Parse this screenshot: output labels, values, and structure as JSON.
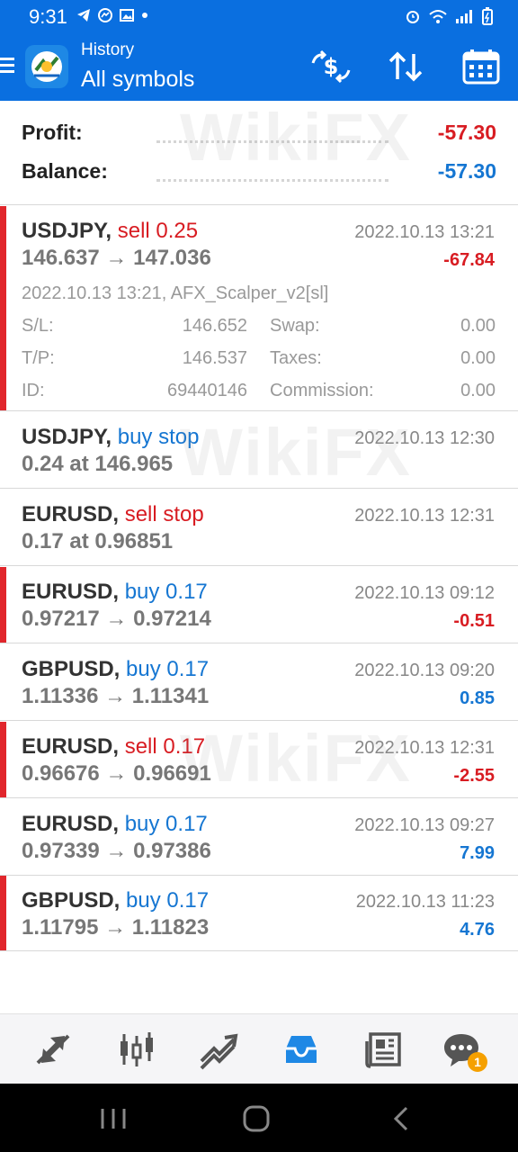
{
  "status_bar": {
    "time": "9:31"
  },
  "header": {
    "subtitle": "History",
    "title": "All symbols",
    "icons": [
      "menu-icon",
      "app-logo",
      "currency-exchange-icon",
      "sort-icon",
      "calendar-icon"
    ]
  },
  "summary": {
    "profit_label": "Profit:",
    "profit_value": "-57.30",
    "balance_label": "Balance:",
    "balance_value": "-57.30"
  },
  "trades": [
    {
      "symbol": "USDJPY,",
      "side": "sell 0.25",
      "side_type": "sell",
      "prices": "146.637 → 147.036",
      "time": "2022.10.13 13:21",
      "profit": "-67.84",
      "marker": true,
      "details": {
        "comment": "2022.10.13 13:21, AFX_Scalper_v2[sl]",
        "sl_label": "S/L:",
        "sl_value": "146.652",
        "tp_label": "T/P:",
        "tp_value": "146.537",
        "id_label": "ID:",
        "id_value": "69440146",
        "swap_label": "Swap:",
        "swap_value": "0.00",
        "taxes_label": "Taxes:",
        "taxes_value": "0.00",
        "commission_label": "Commission:",
        "commission_value": "0.00"
      }
    },
    {
      "symbol": "USDJPY,",
      "side": "buy stop",
      "side_type": "buy",
      "prices": "0.24 at 146.965",
      "time": "2022.10.13 12:30",
      "profit": "",
      "marker": false
    },
    {
      "symbol": "EURUSD,",
      "side": "sell stop",
      "side_type": "sell",
      "prices": "0.17 at 0.96851",
      "time": "2022.10.13 12:31",
      "profit": "",
      "marker": false
    },
    {
      "symbol": "EURUSD,",
      "side": "buy 0.17",
      "side_type": "buy",
      "prices": "0.97217 → 0.97214",
      "time": "2022.10.13 09:12",
      "profit": "-0.51",
      "marker": true
    },
    {
      "symbol": "GBPUSD,",
      "side": "buy 0.17",
      "side_type": "buy",
      "prices": "1.11336 → 1.11341",
      "time": "2022.10.13 09:20",
      "profit": "0.85",
      "marker": false
    },
    {
      "symbol": "EURUSD,",
      "side": "sell 0.17",
      "side_type": "sell",
      "prices": "0.96676 → 0.96691",
      "time": "2022.10.13 12:31",
      "profit": "-2.55",
      "marker": true
    },
    {
      "symbol": "EURUSD,",
      "side": "buy 0.17",
      "side_type": "buy",
      "prices": "0.97339 → 0.97386",
      "time": "2022.10.13 09:27",
      "profit": "7.99",
      "marker": false
    },
    {
      "symbol": "GBPUSD,",
      "side": "buy 0.17",
      "side_type": "buy",
      "prices": "1.11795 → 1.11823",
      "time": "2022.10.13 11:23",
      "profit": "4.76",
      "marker": true
    }
  ],
  "bottom_nav": {
    "items": [
      "quotes-icon",
      "chart-icon",
      "trade-icon",
      "history-icon",
      "news-icon",
      "chat-icon"
    ],
    "active": "history-icon",
    "chat_badge": "1"
  },
  "watermark": "WikiFX",
  "colors": {
    "accent": "#0a6fe0",
    "sell": "#d81c22",
    "buy": "#1576d2",
    "marker": "#e1262c"
  }
}
